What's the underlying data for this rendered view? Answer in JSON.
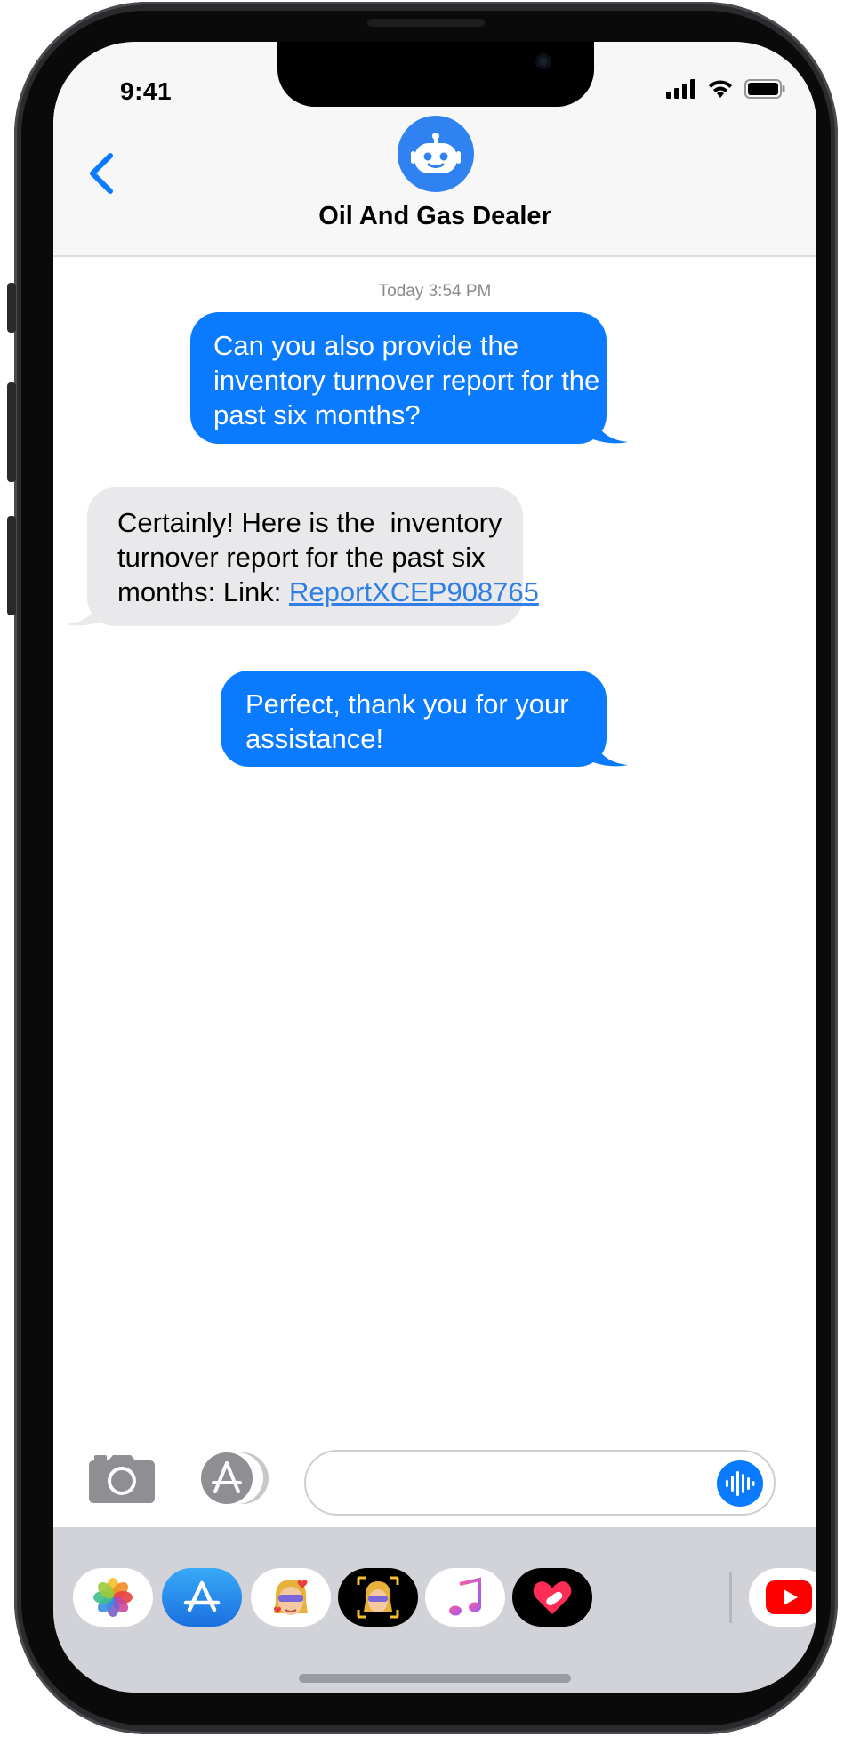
{
  "status_bar": {
    "time": "9:41",
    "icons": [
      "cellular-signal-icon",
      "wifi-icon",
      "battery-icon"
    ]
  },
  "header": {
    "back_icon": "chevron-left-icon",
    "avatar_icon": "robot-icon",
    "contact_name": "Oil And Gas Dealer"
  },
  "conversation": {
    "timestamp": "Today 3:54 PM",
    "messages": [
      {
        "direction": "outgoing",
        "lines": [
          "Can you also provide the",
          "inventory turnover report for the",
          "past six months?"
        ]
      },
      {
        "direction": "incoming",
        "lines": [
          "Certainly! Here is the  inventory",
          "turnover report for the past six",
          "months: Link: "
        ],
        "link_text": "ReportXCEP908765"
      },
      {
        "direction": "outgoing",
        "lines": [
          "Perfect, thank you for your",
          "assistance!"
        ]
      }
    ]
  },
  "composer": {
    "camera_icon": "camera-icon",
    "apps_icon": "app-store-icon",
    "message_value": "",
    "placeholder": "",
    "mic_icon": "audio-waveform-icon"
  },
  "app_tray": {
    "apps": [
      "photos-icon",
      "app-store-icon",
      "memoji-icon",
      "animoji-icon",
      "music-icon",
      "digital-touch-icon",
      "youtube-icon"
    ]
  },
  "colors": {
    "outgoing_bubble": "#0a7aff",
    "incoming_bubble": "#e9e9eb",
    "link": "#2f7fe6",
    "avatar": "#2f82f0",
    "tray_background": "#d1d3d9"
  }
}
